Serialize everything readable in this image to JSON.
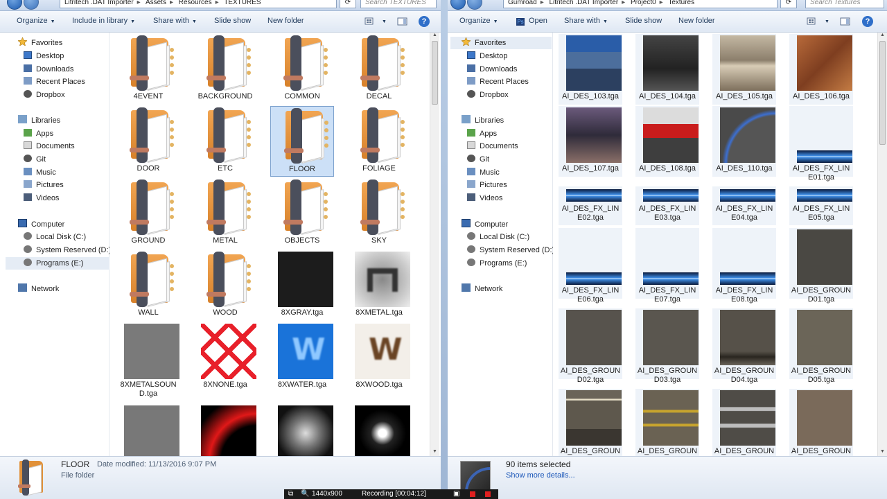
{
  "left": {
    "address": [
      "Litritech .DAT Importer",
      "Assets",
      "Resources",
      "TEXTURES"
    ],
    "search_placeholder": "Search TEXTURES",
    "toolbar": {
      "organize": "Organize",
      "include": "Include in library",
      "share": "Share with",
      "slideshow": "Slide show",
      "newfolder": "New folder"
    },
    "nav": {
      "favorites": "Favorites",
      "desktop": "Desktop",
      "downloads": "Downloads",
      "recent": "Recent Places",
      "dropbox": "Dropbox",
      "libraries": "Libraries",
      "apps": "Apps",
      "documents": "Documents",
      "git": "Git",
      "music": "Music",
      "pictures": "Pictures",
      "videos": "Videos",
      "computer": "Computer",
      "localc": "Local Disk (C:)",
      "sysres": "System Reserved (D:)",
      "programs": "Programs (E:)",
      "network": "Network"
    },
    "items": [
      "4EVENT",
      "BACKGROUND",
      "COMMON",
      "DECAL",
      "DOOR",
      "ETC",
      "FLOOR",
      "FOLIAGE",
      "GROUND",
      "METAL",
      "OBJECTS",
      "SKY",
      "WALL",
      "WOOD",
      "8XGRAY.tga",
      "8XMETAL.tga",
      "8XMETALSOUND.tga",
      "8XNONE.tga",
      "8XWATER.tga",
      "8XWOOD.tga"
    ],
    "details": {
      "name": "FLOOR",
      "modified": "Date modified: 11/13/2016 9:07 PM",
      "type": "File folder"
    }
  },
  "right": {
    "address": [
      "Gumroad",
      "Litritech .DAT Importer",
      "Project0",
      "Textures"
    ],
    "search_placeholder": "Search Textures",
    "toolbar": {
      "organize": "Organize",
      "open": "Open",
      "share": "Share with",
      "slideshow": "Slide show",
      "newfolder": "New folder"
    },
    "nav": {
      "favorites": "Favorites",
      "desktop": "Desktop",
      "downloads": "Downloads",
      "recent": "Recent Places",
      "dropbox": "Dropbox",
      "libraries": "Libraries",
      "apps": "Apps",
      "documents": "Documents",
      "git": "Git",
      "music": "Music",
      "pictures": "Pictures",
      "videos": "Videos",
      "computer": "Computer",
      "localc": "Local Disk (C:)",
      "sysres": "System Reserved (D:)",
      "programs": "Programs (E:)",
      "network": "Network"
    },
    "items": [
      "AI_DES_103.tga",
      "AI_DES_104.tga",
      "AI_DES_105.tga",
      "AI_DES_106.tga",
      "AI_DES_107.tga",
      "AI_DES_108.tga",
      "AI_DES_110.tga",
      "AI_DES_FX_LINE01.tga",
      "AI_DES_FX_LINE02.tga",
      "AI_DES_FX_LINE03.tga",
      "AI_DES_FX_LINE04.tga",
      "AI_DES_FX_LINE05.tga",
      "AI_DES_FX_LINE06.tga",
      "AI_DES_FX_LINE07.tga",
      "AI_DES_FX_LINE08.tga",
      "AI_DES_GROUND01.tga",
      "AI_DES_GROUND02.tga",
      "AI_DES_GROUND03.tga",
      "AI_DES_GROUND04.tga",
      "AI_DES_GROUND05.tga",
      "AI_DES_GROUND",
      "AI_DES_GROUND",
      "AI_DES_GROUND",
      "AI_DES_GROUND"
    ],
    "details": {
      "selected": "90 items selected",
      "more": "Show more details..."
    }
  },
  "recorder": {
    "resolution": "1440x900",
    "status": "Recording [00:04:12]"
  },
  "colors": {
    "accent": "#2f6fc9",
    "selection": "#cce0f7",
    "link": "#1a56b8"
  }
}
